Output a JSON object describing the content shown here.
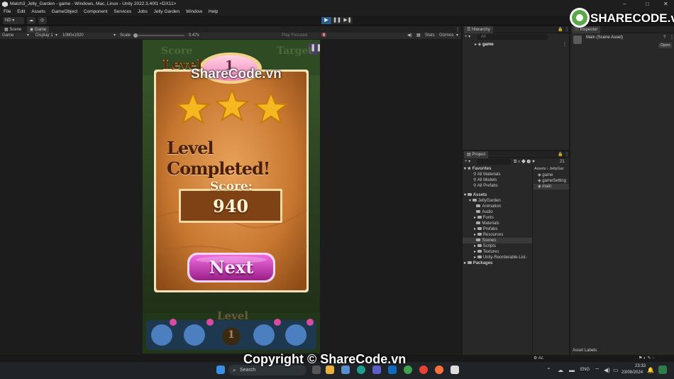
{
  "window": {
    "title": "Match3_Jelly_Garden - game - Windows, Mac, Linux - Unity 2022.3.40f1 <DX11>",
    "minimize": "–",
    "maximize": "□",
    "close": "✕"
  },
  "menu": [
    "File",
    "Edit",
    "Assets",
    "GameObject",
    "Component",
    "Services",
    "Jobs",
    "Jelly Garden",
    "Window",
    "Help"
  ],
  "toolbar": {
    "account_label": "ND ▾",
    "play_icon": "play-icon",
    "pause_icon": "pause-icon",
    "step_icon": "step-icon"
  },
  "scene_tabs": {
    "scene": "Scene",
    "game": "Game"
  },
  "game_bar": {
    "view_select": "Game",
    "display_select": "Display 1",
    "resolution_select": "1080x1920",
    "scale_label": "Scale",
    "scale_value": "0.47x",
    "play_focused": "Play Focused",
    "stats": "Stats",
    "gizmos": "Gizmos"
  },
  "game": {
    "hud_score": "Score",
    "hud_target": "Target",
    "level_label": "Level",
    "level_number": "1",
    "stars_count": 3,
    "completed_text": "Level Completed!",
    "score_label": "Score:",
    "score_value": "940",
    "next_button": "Next",
    "bottom_level_label": "Level",
    "bottom_level_number": "1"
  },
  "hierarchy": {
    "tab": "Hierarchy",
    "search_placeholder": "All",
    "root": "game"
  },
  "inspector": {
    "tab": "Inspector",
    "asset_title": "Main (Scene Asset)",
    "open_button": "Open"
  },
  "project": {
    "tab": "Project",
    "count": "21",
    "favorites_header": "Favorites",
    "favorites": [
      "All Materials",
      "All Models",
      "All Prefabs"
    ],
    "assets_header": "Assets",
    "jelly_garden": "JellyGarden",
    "folders": [
      "Animation",
      "Audio",
      "Fonts",
      "Materials",
      "Prefabs",
      "Resources",
      "Scenes",
      "Scripts",
      "Textures",
      "Unity-Reorderable-List-"
    ],
    "packages": "Packages",
    "breadcrumb_root": "Assets",
    "breadcrumb_child": "JellyGar",
    "files": [
      "game",
      "gameSetting",
      "main"
    ]
  },
  "asset_labels": "Asset Labels",
  "taskbar": {
    "search_placeholder": "Search",
    "lang": "ENG",
    "time": "23:33",
    "date": "23/08/2024"
  },
  "watermark": {
    "logo_text": "SHARECODE.vn",
    "center": "ShareCode.vn",
    "copyright": "Copyright © ShareCode.vn"
  },
  "colors": {
    "accent_blue": "#4a90d9",
    "board_wood": "#c97a32",
    "next_pink": "#c23bb0",
    "star_yellow": "#f5b820"
  }
}
